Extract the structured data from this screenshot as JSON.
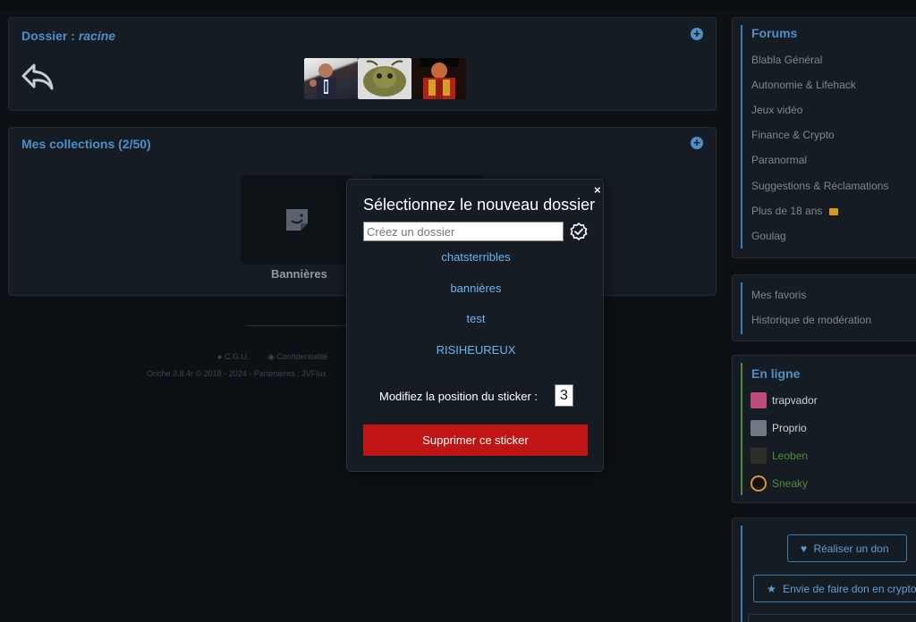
{
  "dossier": {
    "title_prefix": "Dossier : ",
    "title_folder": "racine",
    "add_icon": "plus-circle-icon",
    "back_icon": "reply-arrow-icon",
    "stickers": [
      "sticker-man-in-suit",
      "sticker-moth",
      "sticker-red-warrior"
    ]
  },
  "collections": {
    "title": "Mes collections (2/50)",
    "add_icon": "plus-circle-icon",
    "items": [
      {
        "label": "Bannières",
        "icon": "sticker-icon"
      }
    ]
  },
  "footer": {
    "cgu": "C.G.U.",
    "privacy": "Confidentialité",
    "version_line": "Onche 3.8.4r © 2018 - 2024 - Partenaires : JVFlux"
  },
  "modal": {
    "title": "Sélectionnez le nouveau dossier",
    "close": "×",
    "input_placeholder": "Créez un dossier",
    "input_value": "",
    "folders": [
      "chatsterribles",
      "bannières",
      "test",
      "RISIHEUREUX"
    ],
    "position_label": "Modifiez la position du sticker :",
    "position_value": "3",
    "delete_label": "Supprimer ce sticker"
  },
  "sidebar": {
    "forums": {
      "title": "Forums",
      "items": [
        "Blabla Général",
        "Autonomie & Lifehack",
        "Jeux vidéo",
        "Finance & Crypto",
        "Paranormal",
        "Suggestions & Réclamations",
        "Plus de 18 ans",
        "Goulag"
      ]
    },
    "links": [
      "Mes favoris",
      "Historique de modération"
    ],
    "online": {
      "title": "En ligne",
      "users": [
        {
          "name": "trapvador",
          "color": "#c9d1d9"
        },
        {
          "name": "Proprio",
          "color": "#c9d1d9"
        },
        {
          "name": "Leoben",
          "color": "#4e8c3c"
        },
        {
          "name": "Sneaky",
          "color": "#4e8c3c"
        }
      ]
    },
    "donate": {
      "primary": "Réaliser un don",
      "crypto": "Envie de faire don en crypto"
    }
  },
  "colors": {
    "accent": "#4f8fc8",
    "danger": "#c01515",
    "online_green": "#4e8c3c",
    "background": "#0d1116",
    "panel": "#161c23"
  }
}
